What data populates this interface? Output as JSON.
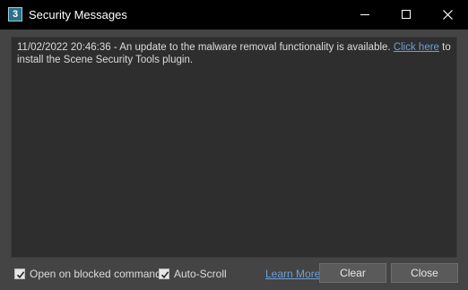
{
  "window": {
    "title": "Security Messages",
    "icon_text": "3",
    "controls": [
      "minimize",
      "maximize",
      "close"
    ]
  },
  "messages": [
    {
      "text_before_link": "11/02/2022 20:46:36 - An update to the malware removal functionality is available. ",
      "link_text": "Click here",
      "text_after_link": " to install the Scene Security Tools plugin."
    }
  ],
  "footer": {
    "open_on_blocked_label": "Open on blocked commands",
    "open_on_blocked_checked": true,
    "auto_scroll_label": "Auto-Scroll",
    "auto_scroll_checked": true,
    "learn_more_label": "Learn More",
    "clear_label": "Clear",
    "close_label": "Close"
  },
  "colors": {
    "titlebar": "#000000",
    "background": "#444444",
    "message_area": "#2e2e2e",
    "link": "#6e9fd8",
    "button": "#5a5a5a"
  }
}
